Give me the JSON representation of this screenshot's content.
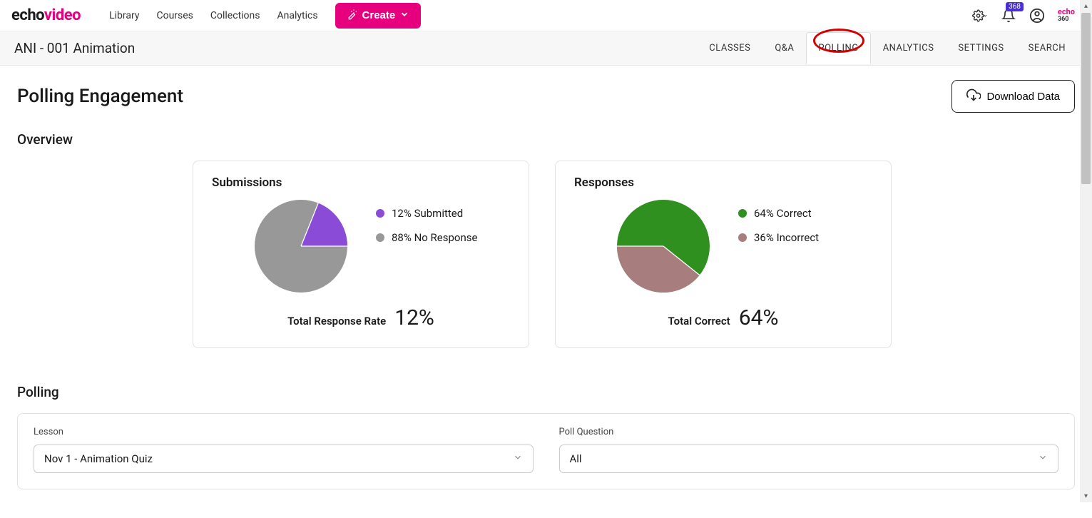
{
  "brand": {
    "part1": "echo",
    "part2": "video"
  },
  "nav": {
    "library": "Library",
    "courses": "Courses",
    "collections": "Collections",
    "analytics": "Analytics"
  },
  "create_label": "Create",
  "notif_count": "368",
  "mini_brand": {
    "part1": "echo",
    "part2": "360"
  },
  "course_title": "ANI - 001 Animation",
  "tabs": {
    "classes": "CLASSES",
    "qa": "Q&A",
    "polling": "POLLING",
    "analytics": "ANALYTICS",
    "settings": "SETTINGS",
    "search": "SEARCH"
  },
  "page_title": "Polling Engagement",
  "download_label": "Download Data",
  "overview_heading": "Overview",
  "submissions": {
    "title": "Submissions",
    "legend1": "12% Submitted",
    "legend2": "88% No Response",
    "foot_label": "Total Response Rate",
    "foot_val": "12%",
    "color1": "#8a4bd6",
    "color2": "#989898"
  },
  "responses": {
    "title": "Responses",
    "legend1": "64% Correct",
    "legend2": "36% Incorrect",
    "foot_label": "Total Correct",
    "foot_val": "64%",
    "color1": "#2f8f1f",
    "color2": "#a77d7d"
  },
  "polling_heading": "Polling",
  "filters": {
    "lesson_label": "Lesson",
    "lesson_value": "Nov 1 - Animation Quiz",
    "question_label": "Poll Question",
    "question_value": "All"
  },
  "chart_data": [
    {
      "type": "pie",
      "title": "Submissions",
      "series": [
        {
          "name": "Submitted",
          "value": 12,
          "color": "#8a4bd6"
        },
        {
          "name": "No Response",
          "value": 88,
          "color": "#989898"
        }
      ]
    },
    {
      "type": "pie",
      "title": "Responses",
      "series": [
        {
          "name": "Correct",
          "value": 64,
          "color": "#2f8f1f"
        },
        {
          "name": "Incorrect",
          "value": 36,
          "color": "#a77d7d"
        }
      ]
    }
  ]
}
